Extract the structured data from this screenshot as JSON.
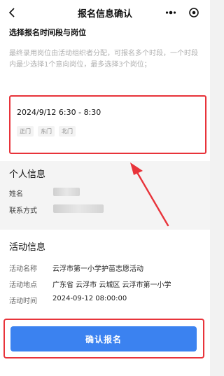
{
  "navbar": {
    "title": "报名信息确认",
    "icons": {
      "back": "back-chevron-icon",
      "more": "more-dots-icon",
      "close": "close-circle-icon"
    }
  },
  "slot_section": {
    "heading": "选择报名时间段与岗位",
    "description": "最终录用岗位由活动组织者分配，可报名多个时段，一个时段内最少选择1个意向岗位，最多选择3个岗位；",
    "time_range": "2024/9/12 6:30 - 8:30",
    "gates": [
      "正门",
      "东门",
      "北门"
    ]
  },
  "personal_info": {
    "title": "个人信息",
    "name_label": "姓名",
    "contact_label": "联系方式"
  },
  "activity_info": {
    "title": "活动信息",
    "rows": [
      {
        "label": "活动名称",
        "value": "云浮市第一小学护苗志愿活动"
      },
      {
        "label": "活动地点",
        "value": "广东省 云浮市 云城区 云浮市第一小学"
      },
      {
        "label": "活动时间",
        "value": "2024-09-12 08:00:00"
      }
    ]
  },
  "submit": {
    "label": "确认报名"
  },
  "colors": {
    "primary": "#3b82f0",
    "annotation_red": "#e8333a",
    "muted_text": "#b0b0b0"
  }
}
